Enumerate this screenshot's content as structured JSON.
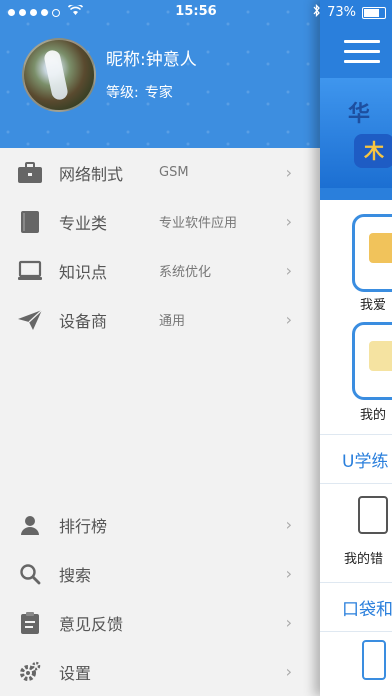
{
  "status_bar": {
    "time": "15:56",
    "battery": "73%"
  },
  "profile": {
    "nickname": "昵称:钟意人",
    "level_label": "等级:",
    "level_value": "专家"
  },
  "menu": [
    {
      "label": "网络制式",
      "value": "GSM",
      "icon": "briefcase-icon"
    },
    {
      "label": "专业类",
      "value": "专业软件应用",
      "icon": "book-icon"
    },
    {
      "label": "知识点",
      "value": "系统优化",
      "icon": "laptop-icon"
    },
    {
      "label": "设备商",
      "value": "通用",
      "icon": "paper-plane-icon"
    }
  ],
  "bottom_menu": [
    {
      "label": "排行榜",
      "icon": "user-rank-icon"
    },
    {
      "label": "搜索",
      "icon": "search-icon"
    },
    {
      "label": "意见反馈",
      "icon": "clipboard-icon"
    },
    {
      "label": "设置",
      "icon": "gear-icon"
    }
  ],
  "main": {
    "banner_text_1": "华",
    "banner_text_2": "木",
    "cell_1_label": "我爱",
    "cell_2_label": "我的",
    "section_1": "U学练",
    "cell_3_label": "我的错",
    "section_2": "口袋和"
  },
  "colors": {
    "accent": "#2a7fdc",
    "header": "#3d8ee0"
  }
}
